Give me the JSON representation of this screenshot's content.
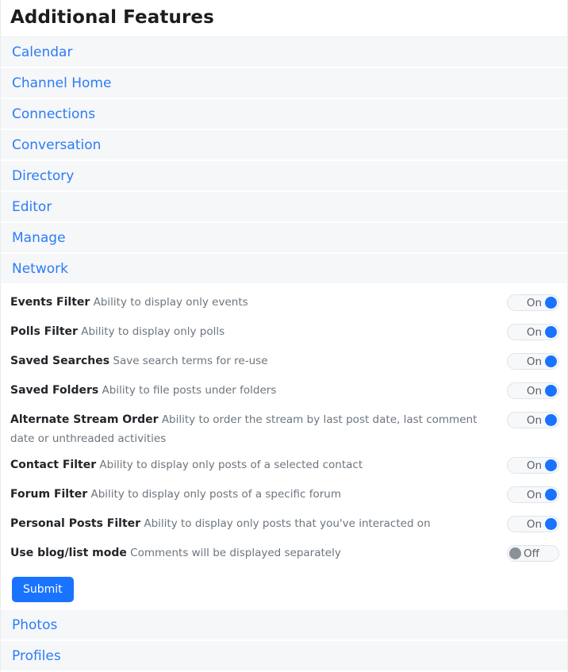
{
  "panel": {
    "title": "Additional Features"
  },
  "accordion_links_top": [
    {
      "label": "Calendar"
    },
    {
      "label": "Channel Home"
    },
    {
      "label": "Connections"
    },
    {
      "label": "Conversation"
    },
    {
      "label": "Directory"
    },
    {
      "label": "Editor"
    },
    {
      "label": "Manage"
    },
    {
      "label": "Network"
    }
  ],
  "features": [
    {
      "name": "Events Filter",
      "description": "Ability to display only events",
      "state": "On",
      "enabled": true
    },
    {
      "name": "Polls Filter",
      "description": "Ability to display only polls",
      "state": "On",
      "enabled": true
    },
    {
      "name": "Saved Searches",
      "description": "Save search terms for re-use",
      "state": "On",
      "enabled": true
    },
    {
      "name": "Saved Folders",
      "description": "Ability to file posts under folders",
      "state": "On",
      "enabled": true
    },
    {
      "name": "Alternate Stream Order",
      "description": "Ability to order the stream by last post date, last comment date or unthreaded activities",
      "state": "On",
      "enabled": true
    },
    {
      "name": "Contact Filter",
      "description": "Ability to display only posts of a selected contact",
      "state": "On",
      "enabled": true
    },
    {
      "name": "Forum Filter",
      "description": "Ability to display only posts of a specific forum",
      "state": "On",
      "enabled": true
    },
    {
      "name": "Personal Posts Filter",
      "description": "Ability to display only posts that you've interacted on",
      "state": "On",
      "enabled": true
    },
    {
      "name": "Use blog/list mode",
      "description": "Comments will be displayed separately",
      "state": "Off",
      "enabled": false
    }
  ],
  "submit": {
    "label": "Submit"
  },
  "accordion_links_bottom": [
    {
      "label": "Photos"
    },
    {
      "label": "Profiles"
    }
  ],
  "colors": {
    "link": "#2b7cf6",
    "accent": "#1a73ff",
    "row_background": "#f6f7f9",
    "toggle_off_knob": "#8b9198",
    "description_text": "#6c757d"
  }
}
